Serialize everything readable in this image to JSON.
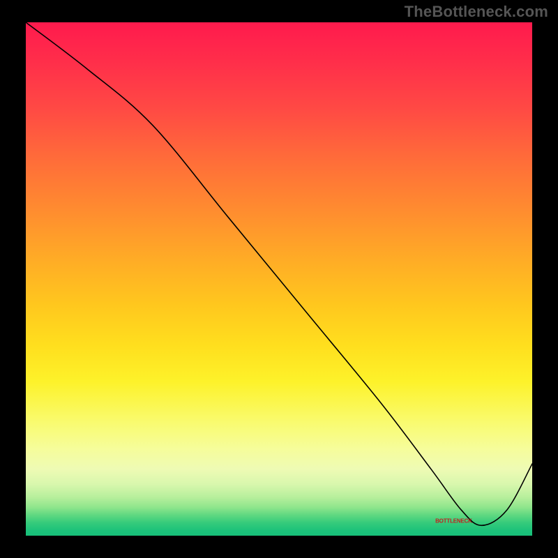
{
  "watermark": "TheBottleneck.com",
  "chart_data": {
    "type": "line",
    "title": "",
    "xlabel": "",
    "ylabel": "",
    "xlim": [
      0,
      100
    ],
    "ylim": [
      0,
      100
    ],
    "x": [
      0,
      12,
      25,
      40,
      55,
      70,
      80,
      86,
      90,
      95,
      100
    ],
    "values": [
      100,
      91,
      80,
      62,
      44,
      26,
      13,
      5,
      2,
      5,
      14
    ],
    "annotation": {
      "text": "BOTTLENECK",
      "x": 85,
      "y": 2.5
    },
    "background_gradient": {
      "direction": "vertical",
      "stops": [
        {
          "pos": 0.0,
          "color": "#ff1a4d"
        },
        {
          "pos": 0.26,
          "color": "#ff6a3a"
        },
        {
          "pos": 0.55,
          "color": "#ffc71e"
        },
        {
          "pos": 0.78,
          "color": "#f9fb70"
        },
        {
          "pos": 0.9,
          "color": "#d8f7ad"
        },
        {
          "pos": 1.0,
          "color": "#17bf79"
        }
      ]
    }
  }
}
